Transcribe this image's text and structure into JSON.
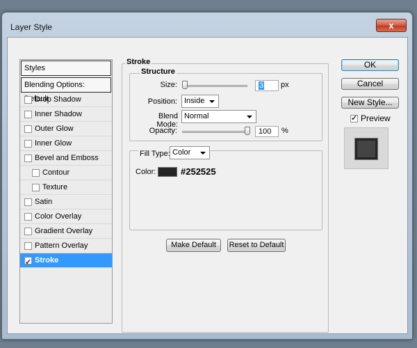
{
  "window": {
    "title": "Layer Style",
    "close_label": "x"
  },
  "styles": {
    "header": "Styles",
    "blending_options": "Blending Options: Default",
    "items": [
      {
        "label": "Drop Shadow",
        "checked": false,
        "sub": false,
        "selected": false
      },
      {
        "label": "Inner Shadow",
        "checked": false,
        "sub": false,
        "selected": false
      },
      {
        "label": "Outer Glow",
        "checked": false,
        "sub": false,
        "selected": false
      },
      {
        "label": "Inner Glow",
        "checked": false,
        "sub": false,
        "selected": false
      },
      {
        "label": "Bevel and Emboss",
        "checked": false,
        "sub": false,
        "selected": false
      },
      {
        "label": "Contour",
        "checked": false,
        "sub": true,
        "selected": false
      },
      {
        "label": "Texture",
        "checked": false,
        "sub": true,
        "selected": false
      },
      {
        "label": "Satin",
        "checked": false,
        "sub": false,
        "selected": false
      },
      {
        "label": "Color Overlay",
        "checked": false,
        "sub": false,
        "selected": false
      },
      {
        "label": "Gradient Overlay",
        "checked": false,
        "sub": false,
        "selected": false
      },
      {
        "label": "Pattern Overlay",
        "checked": false,
        "sub": false,
        "selected": false
      },
      {
        "label": "Stroke",
        "checked": true,
        "sub": false,
        "selected": true
      }
    ]
  },
  "stroke": {
    "section_title": "Stroke",
    "structure_title": "Structure",
    "size_label": "Size:",
    "size_value": "3",
    "size_unit": "px",
    "position_label": "Position:",
    "position_value": "Inside",
    "blend_mode_label": "Blend Mode:",
    "blend_mode_value": "Normal",
    "opacity_label": "Opacity:",
    "opacity_value": "100",
    "opacity_unit": "%",
    "fill_type_label": "Fill Type:",
    "fill_type_value": "Color",
    "color_label": "Color:",
    "color_hex": "#252525",
    "color_swatch": "#252525",
    "make_default": "Make Default",
    "reset_default": "Reset to Default"
  },
  "buttons": {
    "ok": "OK",
    "cancel": "Cancel",
    "new_style": "New Style...",
    "preview_label": "Preview",
    "preview_checked": true
  }
}
